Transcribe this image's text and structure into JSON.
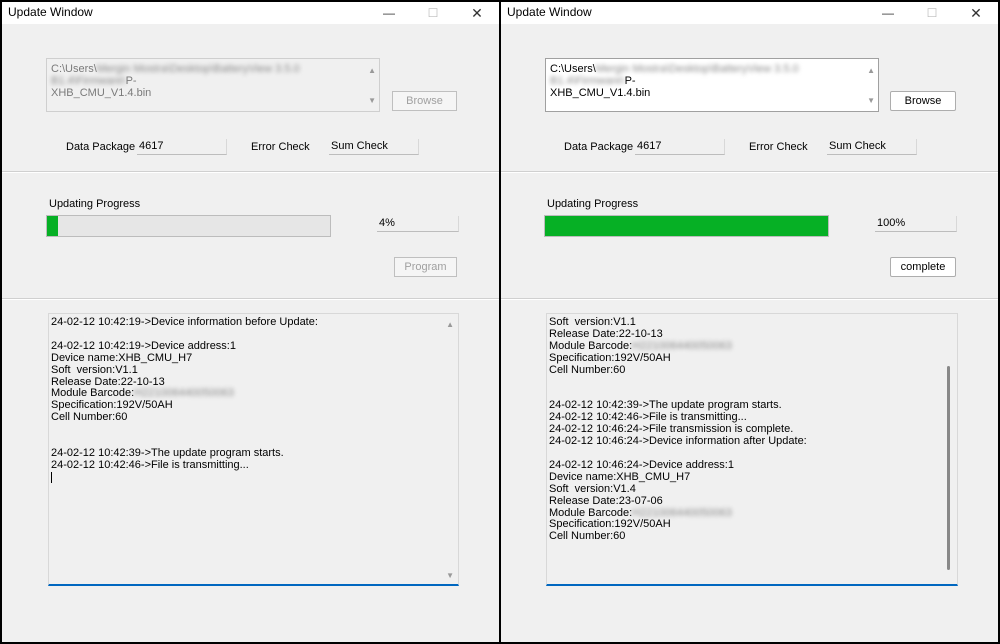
{
  "left": {
    "title": "Update Window",
    "path_prefix": "C:\\Users\\",
    "path_blurred": "Mergin Mostra\\Desktop\\BatteryView 3.5.0 B1.4\\Firmware\\",
    "path_suffix_1": "P-",
    "path_line2": "XHB_CMU_V1.4.bin",
    "browse_label": "Browse",
    "data_package_label": "Data Package",
    "data_package_value": "4617",
    "error_check_label": "Error Check",
    "error_check_value": "Sum Check",
    "progress_label": "Updating Progress",
    "progress_fraction": 0.04,
    "progress_text": "4%",
    "action_label": "Program",
    "log": [
      "24-02-12 10:42:19->Device information before Update:",
      "",
      "24-02-12 10:42:19->Device address:1",
      "Device name:XHB_CMU_H7",
      "Soft  version:V1.1",
      "Release Date:22-10-13",
      "Module Barcode:",
      "Specification:192V/50AH",
      "Cell Number:60",
      "",
      "",
      "24-02-12 10:42:39->The update program starts.",
      "24-02-12 10:42:46->File is transmitting..."
    ],
    "barcode_blurred": "H221006440050063"
  },
  "right": {
    "title": "Update Window",
    "path_prefix": "C:\\Users\\",
    "path_blurred": "Mergin Mostra\\Desktop\\BatteryView 3.5.0 B1.4\\Firmware\\",
    "path_suffix_1": "P-",
    "path_line2": "XHB_CMU_V1.4.bin",
    "browse_label": "Browse",
    "data_package_label": "Data Package",
    "data_package_value": "4617",
    "error_check_label": "Error Check",
    "error_check_value": "Sum Check",
    "progress_label": "Updating Progress",
    "progress_fraction": 1.0,
    "progress_text": "100%",
    "action_label": "complete",
    "log": [
      "Soft  version:V1.1",
      "Release Date:22-10-13",
      "Module Barcode:",
      "Specification:192V/50AH",
      "Cell Number:60",
      "",
      "",
      "24-02-12 10:42:39->The update program starts.",
      "24-02-12 10:42:46->File is transmitting...",
      "24-02-12 10:46:24->File transmission is complete.",
      "24-02-12 10:46:24->Device information after Update:",
      "",
      "24-02-12 10:46:24->Device address:1",
      "Device name:XHB_CMU_H7",
      "Soft  version:V1.4",
      "Release Date:23-07-06",
      "Module Barcode:",
      "Specification:192V/50AH",
      "Cell Number:60"
    ],
    "barcode_blurred": "H221006440050063"
  },
  "window_controls": {
    "minimize": "—",
    "maximize": "☐",
    "close": "✕"
  },
  "colors": {
    "progress_fill": "#06b025",
    "log_underline": "#0067c0"
  }
}
